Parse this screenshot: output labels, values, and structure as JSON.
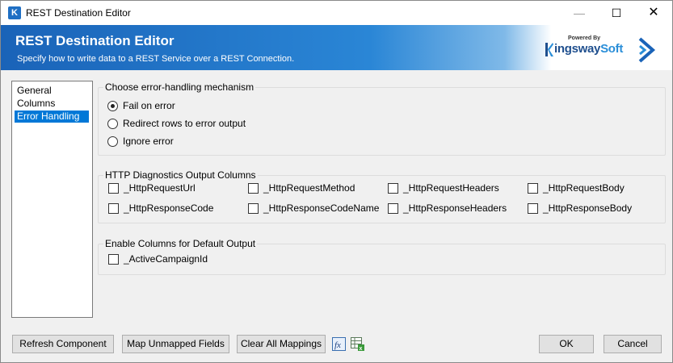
{
  "window": {
    "title": "REST Destination Editor",
    "icon_label": "K"
  },
  "banner": {
    "title": "REST Destination Editor",
    "subtitle": "Specify how to write data to a REST Service over a REST Connection.",
    "brand_powered": "Powered By",
    "brand_name_main": "ingsway",
    "brand_name_soft": "Soft",
    "brand_icon": "kingswaysoft-k-logo",
    "arrow_icon": "chevron-right-icon"
  },
  "nav": {
    "items": [
      {
        "label": "General",
        "selected": false
      },
      {
        "label": "Columns",
        "selected": false
      },
      {
        "label": "Error Handling",
        "selected": true
      }
    ]
  },
  "error_handling": {
    "group_label": "Choose error-handling mechanism",
    "options": [
      {
        "label": "Fail on error",
        "checked": true
      },
      {
        "label": "Redirect rows to error output",
        "checked": false
      },
      {
        "label": "Ignore error",
        "checked": false
      }
    ]
  },
  "diagnostics": {
    "group_label": "HTTP Diagnostics Output Columns",
    "columns": [
      {
        "label": "_HttpRequestUrl",
        "checked": false
      },
      {
        "label": "_HttpRequestMethod",
        "checked": false
      },
      {
        "label": "_HttpRequestHeaders",
        "checked": false
      },
      {
        "label": "_HttpRequestBody",
        "checked": false
      },
      {
        "label": "_HttpResponseCode",
        "checked": false
      },
      {
        "label": "_HttpResponseCodeName",
        "checked": false
      },
      {
        "label": "_HttpResponseHeaders",
        "checked": false
      },
      {
        "label": "_HttpResponseBody",
        "checked": false
      }
    ]
  },
  "default_output": {
    "group_label": "Enable Columns for Default Output",
    "columns": [
      {
        "label": "_ActiveCampaignId",
        "checked": false
      }
    ]
  },
  "footer": {
    "refresh": "Refresh Component",
    "map_unmapped": "Map Unmapped Fields",
    "clear_mappings": "Clear All Mappings",
    "expression_icon": "fx-expression-icon",
    "table_icon": "grid-export-icon",
    "ok": "OK",
    "cancel": "Cancel"
  },
  "colors": {
    "accent": "#0078d7",
    "banner_start": "#1a63b8",
    "banner_end": "#2a86d6"
  }
}
